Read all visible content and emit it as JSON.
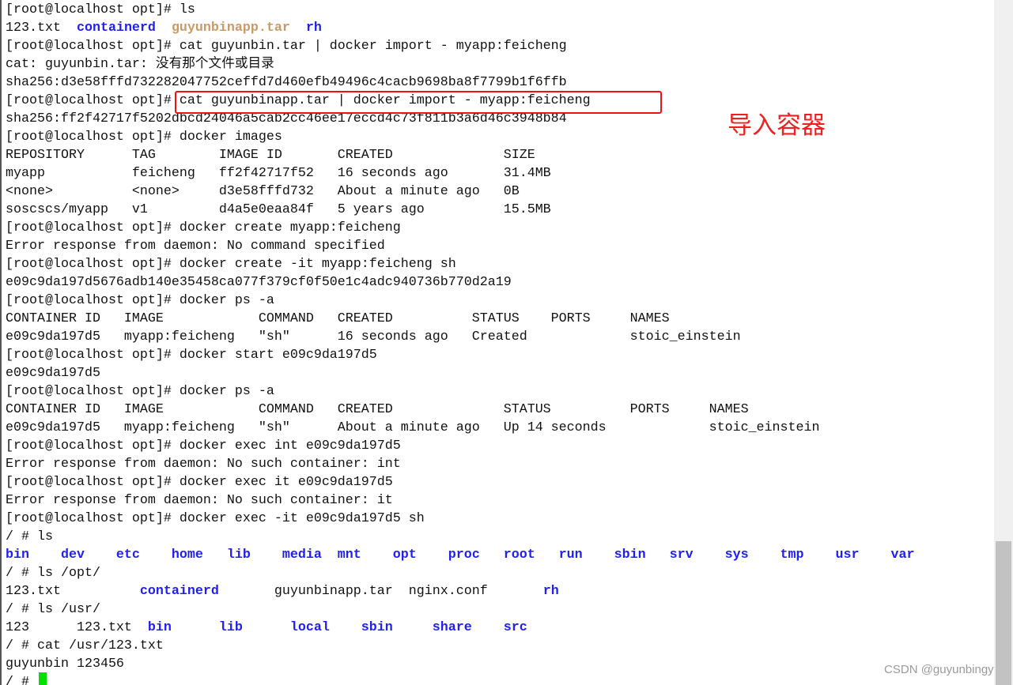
{
  "terminal": {
    "lines": [
      [
        {
          "t": "[root@localhost opt]# ls"
        }
      ],
      [
        {
          "t": "123.txt  "
        },
        {
          "t": "containerd",
          "s": "blue"
        },
        {
          "t": "  "
        },
        {
          "t": "guyunbinapp.tar",
          "s": "tan"
        },
        {
          "t": "  "
        },
        {
          "t": "rh",
          "s": "blue"
        }
      ],
      [
        {
          "t": "[root@localhost opt]# cat guyunbin.tar | docker import - myapp:feicheng"
        }
      ],
      [
        {
          "t": "cat: guyunbin.tar: 没有那个文件或目录"
        }
      ],
      [
        {
          "t": "sha256:d3e58fffd732282047752ceffd7d460efb49496c4cacb9698ba8f7799b1f6ffb"
        }
      ],
      [
        {
          "t": "[root@localhost opt]# cat guyunbinapp.tar | docker import - myapp:feicheng"
        }
      ],
      [
        {
          "t": "sha256:ff2f42717f5202dbcd24046a5cab2cc46ee17eccd4c73f811b3a6d46c3948b84"
        }
      ],
      [
        {
          "t": "[root@localhost opt]# docker images"
        }
      ],
      [
        {
          "t": "REPOSITORY      TAG        IMAGE ID       CREATED              SIZE"
        }
      ],
      [
        {
          "t": "myapp           feicheng   ff2f42717f52   16 seconds ago       31.4MB"
        }
      ],
      [
        {
          "t": "<none>          <none>     d3e58fffd732   About a minute ago   0B"
        }
      ],
      [
        {
          "t": "soscscs/myapp   v1         d4a5e0eaa84f   5 years ago          15.5MB"
        }
      ],
      [
        {
          "t": "[root@localhost opt]# docker create myapp:feicheng"
        }
      ],
      [
        {
          "t": "Error response from daemon: No command specified"
        }
      ],
      [
        {
          "t": "[root@localhost opt]# docker create -it myapp:feicheng sh"
        }
      ],
      [
        {
          "t": "e09c9da197d5676adb140e35458ca077f379cf0f50e1c4adc940736b770d2a19"
        }
      ],
      [
        {
          "t": "[root@localhost opt]# docker ps -a"
        }
      ],
      [
        {
          "t": "CONTAINER ID   IMAGE            COMMAND   CREATED          STATUS    PORTS     NAMES"
        }
      ],
      [
        {
          "t": "e09c9da197d5   myapp:feicheng   \"sh\"      16 seconds ago   Created             stoic_einstein"
        }
      ],
      [
        {
          "t": "[root@localhost opt]# docker start e09c9da197d5"
        }
      ],
      [
        {
          "t": "e09c9da197d5"
        }
      ],
      [
        {
          "t": "[root@localhost opt]# docker ps -a"
        }
      ],
      [
        {
          "t": "CONTAINER ID   IMAGE            COMMAND   CREATED              STATUS          PORTS     NAMES"
        }
      ],
      [
        {
          "t": "e09c9da197d5   myapp:feicheng   \"sh\"      About a minute ago   Up 14 seconds             stoic_einstein"
        }
      ],
      [
        {
          "t": "[root@localhost opt]# docker exec int e09c9da197d5"
        }
      ],
      [
        {
          "t": "Error response from daemon: No such container: int"
        }
      ],
      [
        {
          "t": "[root@localhost opt]# docker exec it e09c9da197d5"
        }
      ],
      [
        {
          "t": "Error response from daemon: No such container: it"
        }
      ],
      [
        {
          "t": "[root@localhost opt]# docker exec -it e09c9da197d5 sh"
        }
      ],
      [
        {
          "t": "/ # ls"
        }
      ],
      [
        {
          "t": "bin    dev    etc    home   lib    media  mnt    opt    proc   root   run    sbin   srv    sys    tmp    usr    var",
          "s": "blue"
        }
      ],
      [
        {
          "t": "/ # ls /opt/"
        }
      ],
      [
        {
          "t": "123.txt          "
        },
        {
          "t": "containerd",
          "s": "blue"
        },
        {
          "t": "       guyunbinapp.tar  nginx.conf       "
        },
        {
          "t": "rh",
          "s": "blue"
        }
      ],
      [
        {
          "t": "/ # ls /usr/"
        }
      ],
      [
        {
          "t": "123      123.txt  "
        },
        {
          "t": "bin      lib      local    sbin     share    src",
          "s": "blue"
        }
      ],
      [
        {
          "t": "/ # cat /usr/123.txt"
        }
      ],
      [
        {
          "t": "guyunbin 123456"
        }
      ],
      [
        {
          "t": "/ # "
        }
      ]
    ],
    "annotation": "导入容器",
    "annotation_color": "#f02020",
    "highlight_color": "#f01010",
    "cursor_color": "#00e000",
    "watermark": "CSDN @guyunbingyb"
  }
}
